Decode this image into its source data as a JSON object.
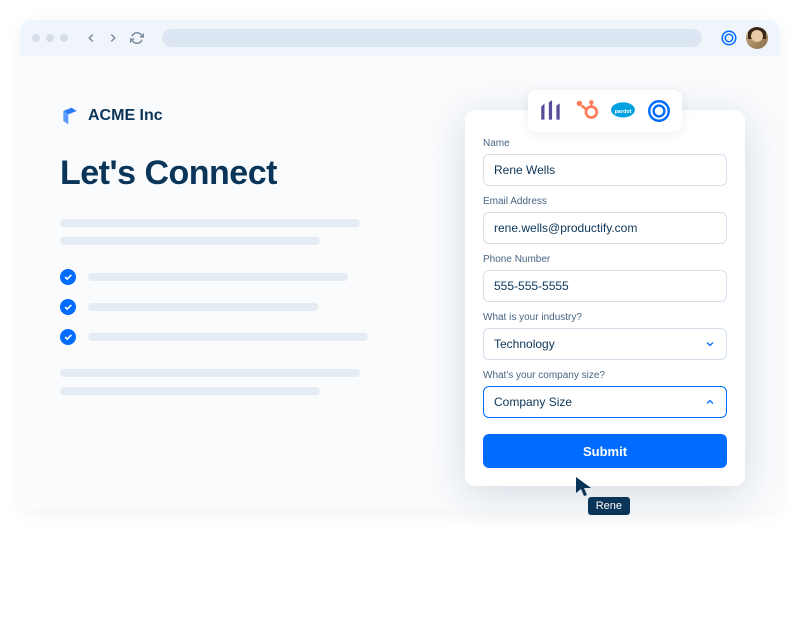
{
  "brand": {
    "name": "ACME Inc"
  },
  "headline": "Let's Connect",
  "integrations": [
    "marketo",
    "hubspot",
    "salesforce",
    "calendly"
  ],
  "form": {
    "name": {
      "label": "Name",
      "value": "Rene Wells"
    },
    "email": {
      "label": "Email Address",
      "value": "rene.wells@productify.com"
    },
    "phone": {
      "label": "Phone Number",
      "value": "555-555-5555"
    },
    "industry": {
      "label": "What is your industry?",
      "value": "Technology"
    },
    "companySize": {
      "label": "What's your company size?",
      "placeholder": "Company Size"
    },
    "submit": "Submit"
  },
  "cursor": {
    "label": "Rene"
  }
}
